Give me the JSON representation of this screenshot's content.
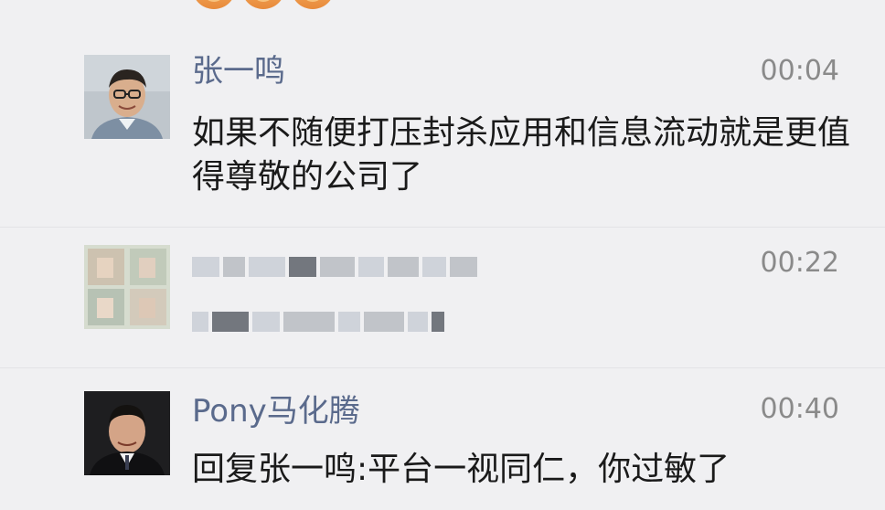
{
  "comments": [
    {
      "author": "张一鸣",
      "time": "00:04",
      "text": "如果不随便打压封杀应用和信息流动就是更值得尊敬的公司了",
      "avatar_icon": "person-photo-avatar"
    },
    {
      "author": "",
      "time": "00:22",
      "text": "",
      "avatar_icon": "blurred-avatar",
      "blurred": true
    },
    {
      "author": "Pony马化腾",
      "time": "00:40",
      "text": "回复张一鸣:平台一视同仁，你过敏了",
      "avatar_icon": "person-photo-avatar"
    }
  ],
  "colors": {
    "author": "#5a6a8c",
    "time": "#8a8a8a",
    "text": "#1a1a1a",
    "background": "#f0f0f2"
  }
}
